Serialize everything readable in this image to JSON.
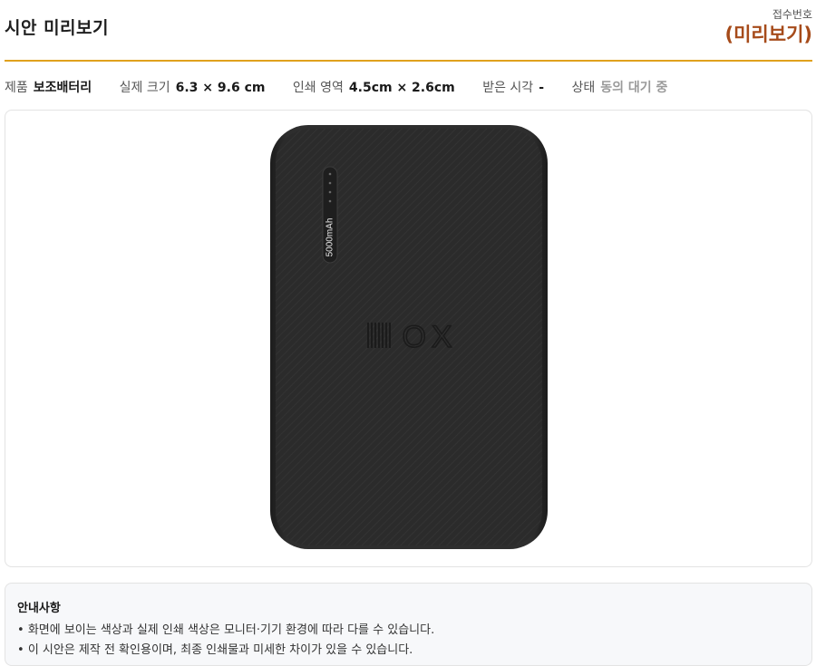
{
  "header": {
    "title": "시안 미리보기",
    "receipt_label": "접수번호",
    "receipt_value": "(미리보기)"
  },
  "info": [
    {
      "label": "제품",
      "value": "보조배터리"
    },
    {
      "label": "실제 크기",
      "value": "6.3 × 9.6 cm"
    },
    {
      "label": "인쇄 영역",
      "value": "4.5cm × 2.6cm"
    },
    {
      "label": "받은 시각",
      "value": "-"
    },
    {
      "label": "상태",
      "value": "동의 대기 중"
    }
  ],
  "product": {
    "capacity_text": "5000mAh",
    "logo_text": "OX",
    "body_color": "#2b2b2b"
  },
  "notice": {
    "title": "안내사항",
    "items": [
      "화면에 보이는 색상과 실제 인쇄 색상은 모니터·기기 환경에 따라 다를 수 있습니다.",
      "이 시안은 제작 전 확인용이며, 최종 인쇄물과 미세한 차이가 있을 수 있습니다."
    ]
  },
  "colors": {
    "accent": "#e0a11d",
    "receipt": "#a64b1a",
    "status": "#9a9a9a"
  }
}
